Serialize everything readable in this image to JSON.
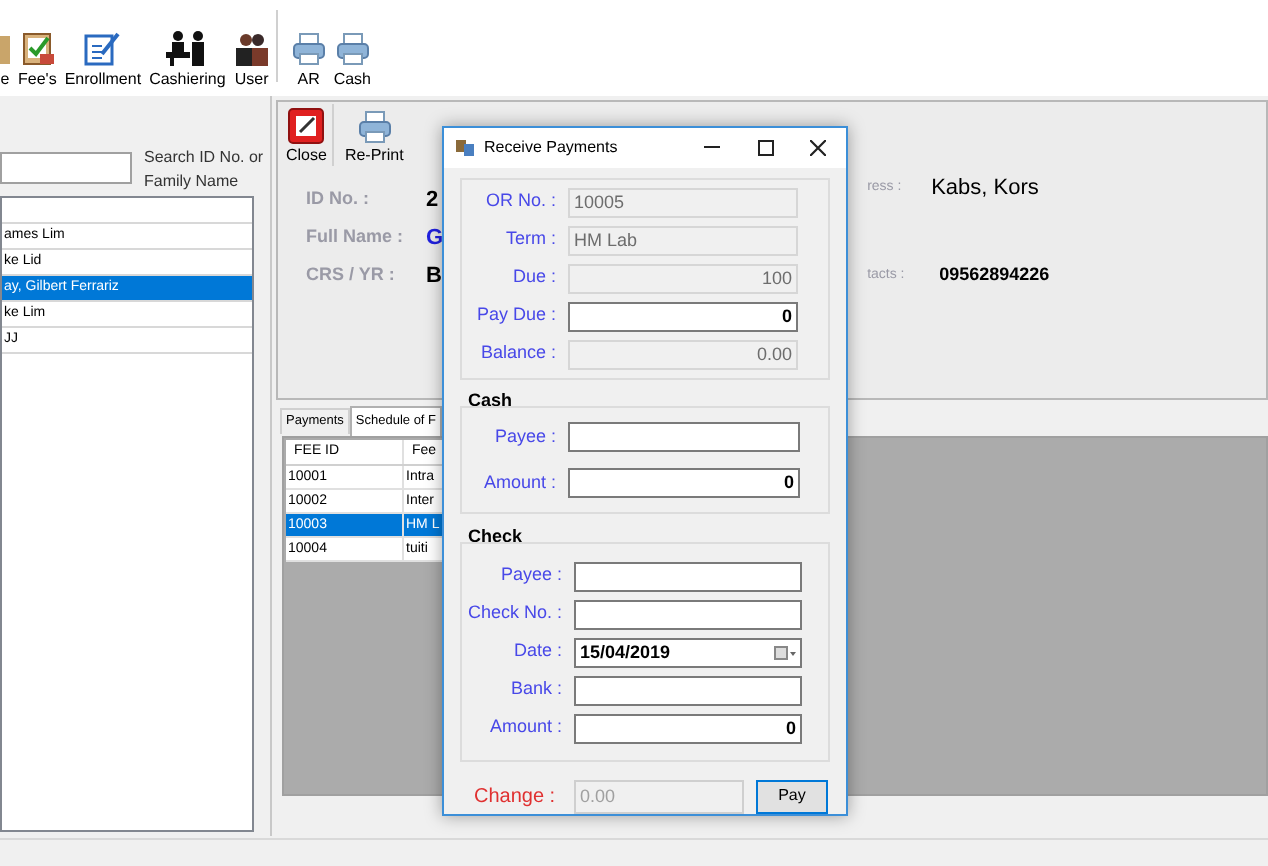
{
  "toolbar": [
    {
      "label": "e"
    },
    {
      "label": "Fee's"
    },
    {
      "label": "Enrollment"
    },
    {
      "label": "Cashiering"
    },
    {
      "label": "User"
    },
    {
      "label": "AR"
    },
    {
      "label": "Cash"
    }
  ],
  "student_search": {
    "label": "Search ID No. or Family Name"
  },
  "student_list": [
    {
      "selected": false
    },
    {
      "name": "ames Lim",
      "selected": false
    },
    {
      "name": "ke Lid",
      "selected": false
    },
    {
      "name": "ay, Gilbert Ferrariz",
      "selected": true
    },
    {
      "name": "ke Lim",
      "selected": false
    },
    {
      "name": "JJ",
      "selected": false
    }
  ],
  "actions": [
    {
      "label": "Close"
    },
    {
      "label": "Re-Print"
    }
  ],
  "student_info": [
    {
      "label": "ID No. :",
      "value": "2",
      "kind": "plain"
    },
    {
      "label": "Full Name :",
      "value": "G",
      "kind": "link"
    },
    {
      "label": "CRS / YR :",
      "value": "B",
      "kind": "plain"
    }
  ],
  "student_info_right": [
    {
      "label": "ress :",
      "value": "Kabs, Kors"
    },
    {
      "label": "tacts :",
      "value": "09562894226"
    }
  ],
  "tabs": [
    {
      "label": "Payments",
      "selected": false
    },
    {
      "label": "Schedule of F",
      "selected": true
    }
  ],
  "fees_table": {
    "columns": [
      "FEE ID",
      "Fee"
    ],
    "rows": [
      {
        "cells": [
          "10001",
          "Intra"
        ],
        "selected": false
      },
      {
        "cells": [
          "10002",
          "Inter"
        ],
        "selected": false
      },
      {
        "cells": [
          "10003",
          "HM L"
        ],
        "selected": true
      },
      {
        "cells": [
          "10004",
          "tuiti"
        ],
        "selected": false
      }
    ]
  },
  "dialog": {
    "title": "Receive Payments",
    "summary": [
      {
        "label": "OR No. :",
        "value": "10005",
        "kind": "text",
        "disabled": true
      },
      {
        "label": "Term :",
        "value": "HM Lab",
        "kind": "text",
        "disabled": true
      },
      {
        "label": "Due :",
        "value": "100",
        "kind": "number",
        "disabled": true
      },
      {
        "label": "Pay Due :",
        "value": "0",
        "kind": "number",
        "disabled": false
      },
      {
        "label": "Balance :",
        "value": "0.00",
        "kind": "number",
        "disabled": true
      }
    ],
    "cash": {
      "title": "Cash",
      "fields": [
        {
          "label": "Payee :",
          "kind": "text"
        },
        {
          "label": "Amount :",
          "value": "0",
          "kind": "number"
        }
      ]
    },
    "check": {
      "title": "Check",
      "fields": [
        {
          "label": "Payee :",
          "kind": "text"
        },
        {
          "label": "Check No. :",
          "kind": "text"
        },
        {
          "label": "Date :",
          "value": "15/04/2019",
          "kind": "date"
        },
        {
          "label": "Bank :",
          "kind": "text"
        },
        {
          "label": "Amount :",
          "value": "0",
          "kind": "number"
        }
      ]
    },
    "change": {
      "label": "Change :",
      "value": "0.00"
    },
    "pay_button": "Pay"
  }
}
